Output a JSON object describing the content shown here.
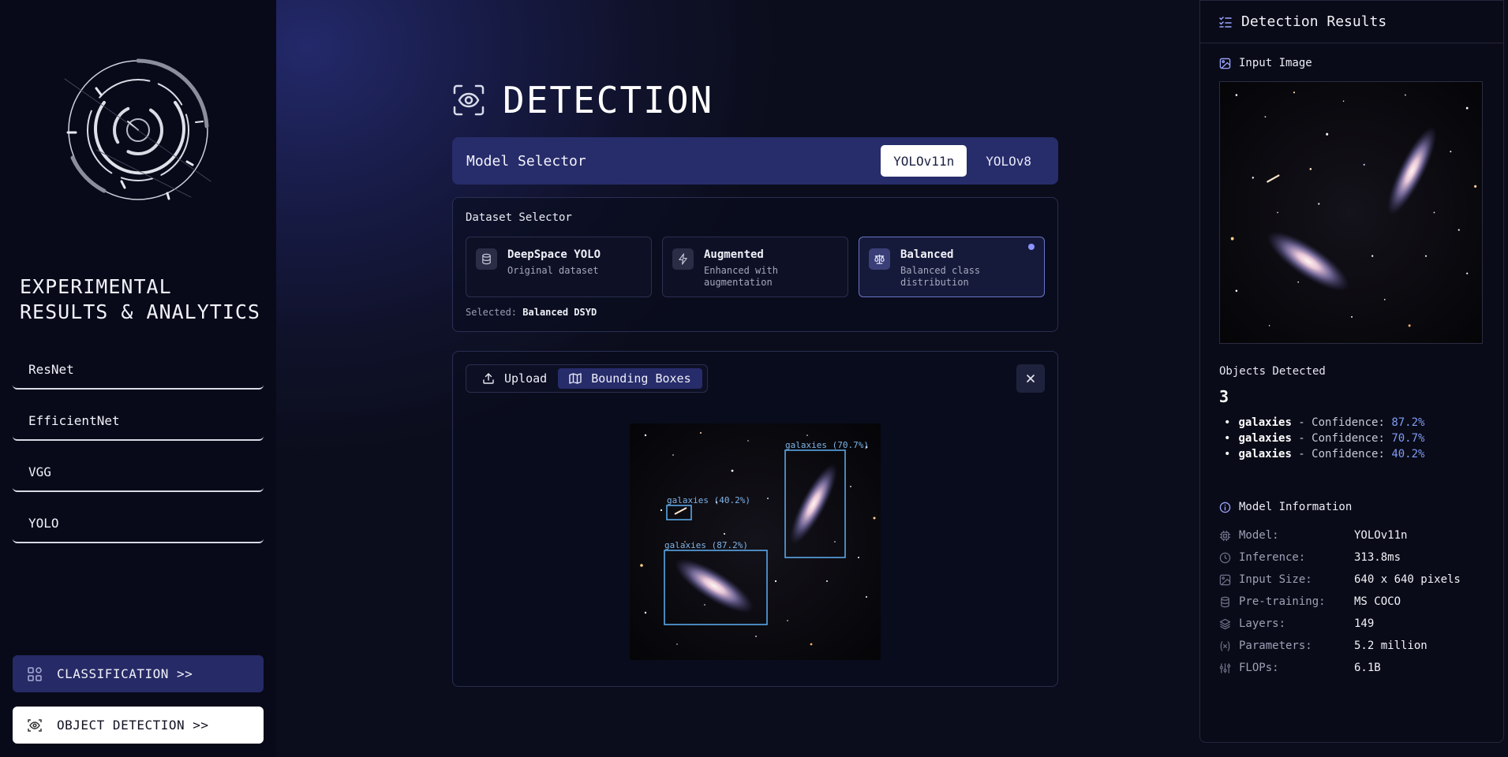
{
  "sidebar": {
    "title": "EXPERIMENTAL RESULTS & ANALYTICS",
    "nav": [
      "ResNet",
      "EfficientNet",
      "VGG",
      "YOLO"
    ],
    "classification_label": "CLASSIFICATION >>",
    "detection_label": "OBJECT DETECTION >>"
  },
  "main": {
    "title": "DETECTION",
    "model_selector": {
      "label": "Model Selector",
      "options": [
        "YOLOv11n",
        "YOLOv8"
      ],
      "active": "YOLOv11n"
    },
    "dataset_selector": {
      "label": "Dataset Selector",
      "cards": [
        {
          "name": "DeepSpace YOLO",
          "desc": "Original dataset",
          "icon": "database-icon"
        },
        {
          "name": "Augmented",
          "desc": "Enhanced with augmentation",
          "icon": "lightning-icon"
        },
        {
          "name": "Balanced",
          "desc": "Balanced class distribution",
          "icon": "scale-icon"
        }
      ],
      "selected_prefix": "Selected:",
      "selected_value": "Balanced DSYD"
    },
    "tabs": {
      "upload": "Upload",
      "boxes": "Bounding Boxes"
    },
    "detections": [
      {
        "label": "galaxies (87.2%)"
      },
      {
        "label": "galaxies (70.7%)"
      },
      {
        "label": "galaxies (40.2%)"
      }
    ]
  },
  "results": {
    "header": "Detection Results",
    "input_label": "Input Image",
    "objects_label": "Objects Detected",
    "count": "3",
    "objects": [
      {
        "cls": "galaxies",
        "sep": " - Confidence: ",
        "conf": "87.2%"
      },
      {
        "cls": "galaxies",
        "sep": " - Confidence: ",
        "conf": "70.7%"
      },
      {
        "cls": "galaxies",
        "sep": " - Confidence: ",
        "conf": "40.2%"
      }
    ],
    "model_info_label": "Model Information",
    "info": [
      {
        "k": "Model:",
        "v": "YOLOv11n",
        "icon": "cpu-icon"
      },
      {
        "k": "Inference:",
        "v": "313.8ms",
        "icon": "clock-icon"
      },
      {
        "k": "Input Size:",
        "v": "640 x 640 pixels",
        "icon": "image-icon"
      },
      {
        "k": "Pre-training:",
        "v": "MS COCO",
        "icon": "database-icon"
      },
      {
        "k": "Layers:",
        "v": "149",
        "icon": "layers-icon"
      },
      {
        "k": "Parameters:",
        "v": "5.2 million",
        "icon": "variable-icon"
      },
      {
        "k": "FLOPs:",
        "v": "6.1B",
        "icon": "sliders-icon"
      }
    ]
  },
  "colors": {
    "accent": "#272c6b",
    "confidence": "#7f9cf5",
    "bbox": "#5aa6e6"
  }
}
